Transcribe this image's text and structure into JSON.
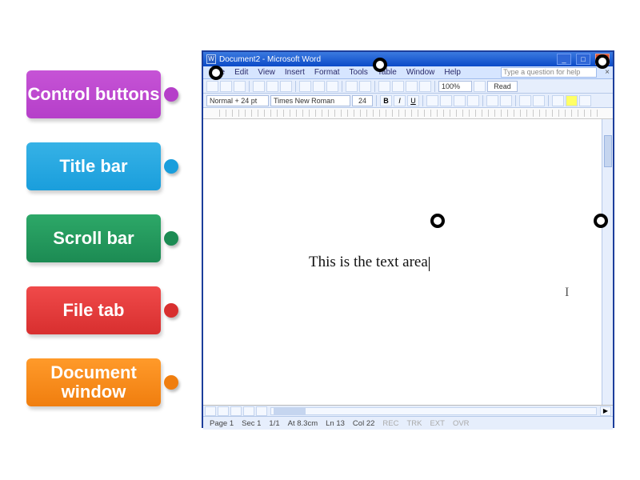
{
  "labels": {
    "control_buttons": "Control buttons",
    "title_bar": "Title bar",
    "scroll_bar": "Scroll bar",
    "file_tab": "File tab",
    "document_window": "Document window"
  },
  "window": {
    "title": "Document2 - Microsoft Word",
    "menus": [
      "File",
      "Edit",
      "View",
      "Insert",
      "Format",
      "Tools",
      "Table",
      "Window",
      "Help"
    ],
    "help_placeholder": "Type a question for help",
    "style_box": "Normal + 24 pt",
    "font_box": "Times New Roman",
    "size_box": "24",
    "zoom_box": "100%",
    "read_btn": "Read",
    "doc_text": "This is the text area",
    "status": {
      "page": "Page 1",
      "sec": "Sec 1",
      "pages": "1/1",
      "at": "At 8.3cm",
      "ln": "Ln 13",
      "col": "Col 22",
      "flags": [
        "REC",
        "TRK",
        "EXT",
        "OVR"
      ]
    }
  }
}
